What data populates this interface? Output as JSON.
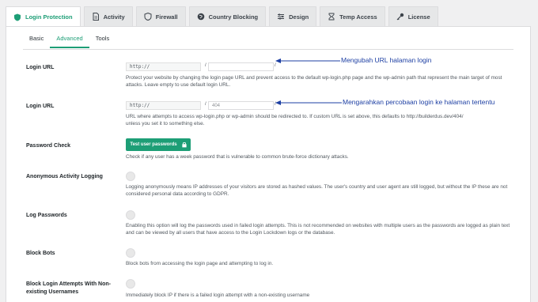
{
  "tabs": [
    {
      "label": "Login Protection",
      "icon": "shield-icon",
      "active": true
    },
    {
      "label": "Activity",
      "icon": "document-icon"
    },
    {
      "label": "Firewall",
      "icon": "shield-outline-icon"
    },
    {
      "label": "Country Blocking",
      "icon": "globe-icon"
    },
    {
      "label": "Design",
      "icon": "sliders-icon"
    },
    {
      "label": "Temp Access",
      "icon": "hourglass-icon"
    },
    {
      "label": "License",
      "icon": "key-icon"
    }
  ],
  "subtabs": [
    {
      "label": "Basic"
    },
    {
      "label": "Advanced",
      "active": true
    },
    {
      "label": "Tools"
    }
  ],
  "rows": {
    "login_url": {
      "label": "Login URL",
      "url_prefix": "http://",
      "slash": "/",
      "slug_value": "",
      "slug_slash": "/",
      "desc": "Protect your website by changing the login page URL and prevent access to the default wp-login.php page and the wp-admin path that represent the main target of most attacks. Leave empty to use default login URL."
    },
    "redirect_url": {
      "label": "Login URL",
      "url_prefix": "http://",
      "slash": "/",
      "slug_placeholder": "404",
      "slug_slash": "/",
      "desc": "URL where attempts to access wp-login.php or wp-admin should be redirected to. If custom URL is set above, this defaults to http://builderdus.dev/404/ unless you set it to something else."
    },
    "password_check": {
      "label": "Password Check",
      "button": "Test user passwords",
      "desc": "Check if any user has a week password that is vulnerable to common brute-force dictionary attacks."
    },
    "anonymous": {
      "label": "Anonymous Activity Logging",
      "desc": "Logging anonymously means IP addresses of your visitors are stored as hashed values. The user's country and user agent are still logged, but without the IP these are not considered personal data according to GDPR."
    },
    "log_passwords": {
      "label": "Log Passwords",
      "desc": "Enabling this option will log the passwords used in failed login attempts. This is not recommended on websites with multiple users as the passwords are logged as plain text and can be viewed by all users that have access to the Login Lockdown logs or the database."
    },
    "block_bots": {
      "label": "Block Bots",
      "desc": "Block bots from accessing the login page and attempting to log in."
    },
    "block_nonexisting": {
      "label": "Block Login Attempts With Non-existing Usernames",
      "desc": "Immediately block IP if there is a failed login attempt with a non-existing username"
    }
  },
  "annotations": {
    "first": "Mengubah URL halaman login",
    "second": "Mengarahkan percobaan login ke halaman tertentu"
  },
  "colors": {
    "accent": "#1d9e76",
    "annotation": "#1d3fa3"
  }
}
